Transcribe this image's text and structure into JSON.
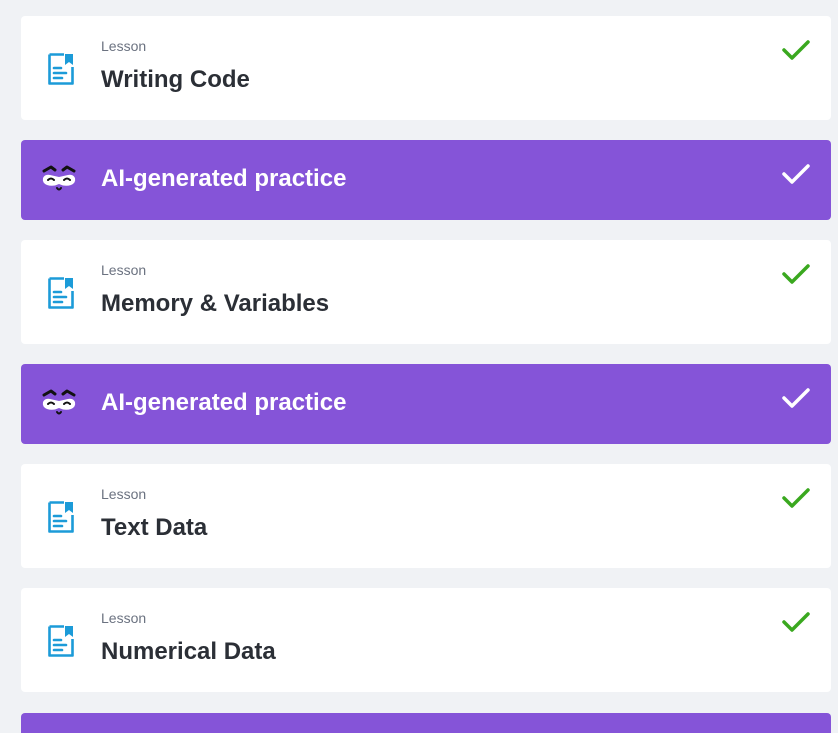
{
  "colors": {
    "page_bg": "#f0f2f5",
    "card_bg": "#ffffff",
    "practice_bg": "#8554d8",
    "doc_icon": "#1c9bd8",
    "check_green": "#3aa81f",
    "check_white": "#ffffff",
    "title_text": "#2b2f36",
    "kind_text": "#6b7280"
  },
  "items": [
    {
      "type": "lesson",
      "kind_label": "Lesson",
      "title": "Writing Code",
      "icon": "document-icon",
      "completed": true
    },
    {
      "type": "practice",
      "title": "AI-generated practice",
      "icon": "mask-face-icon",
      "completed": true
    },
    {
      "type": "lesson",
      "kind_label": "Lesson",
      "title": "Memory & Variables",
      "icon": "document-icon",
      "completed": true
    },
    {
      "type": "practice",
      "title": "AI-generated practice",
      "icon": "mask-face-icon",
      "completed": true
    },
    {
      "type": "lesson",
      "kind_label": "Lesson",
      "title": "Text Data",
      "icon": "document-icon",
      "completed": true
    },
    {
      "type": "lesson",
      "kind_label": "Lesson",
      "title": "Numerical Data",
      "icon": "document-icon",
      "completed": true
    }
  ]
}
